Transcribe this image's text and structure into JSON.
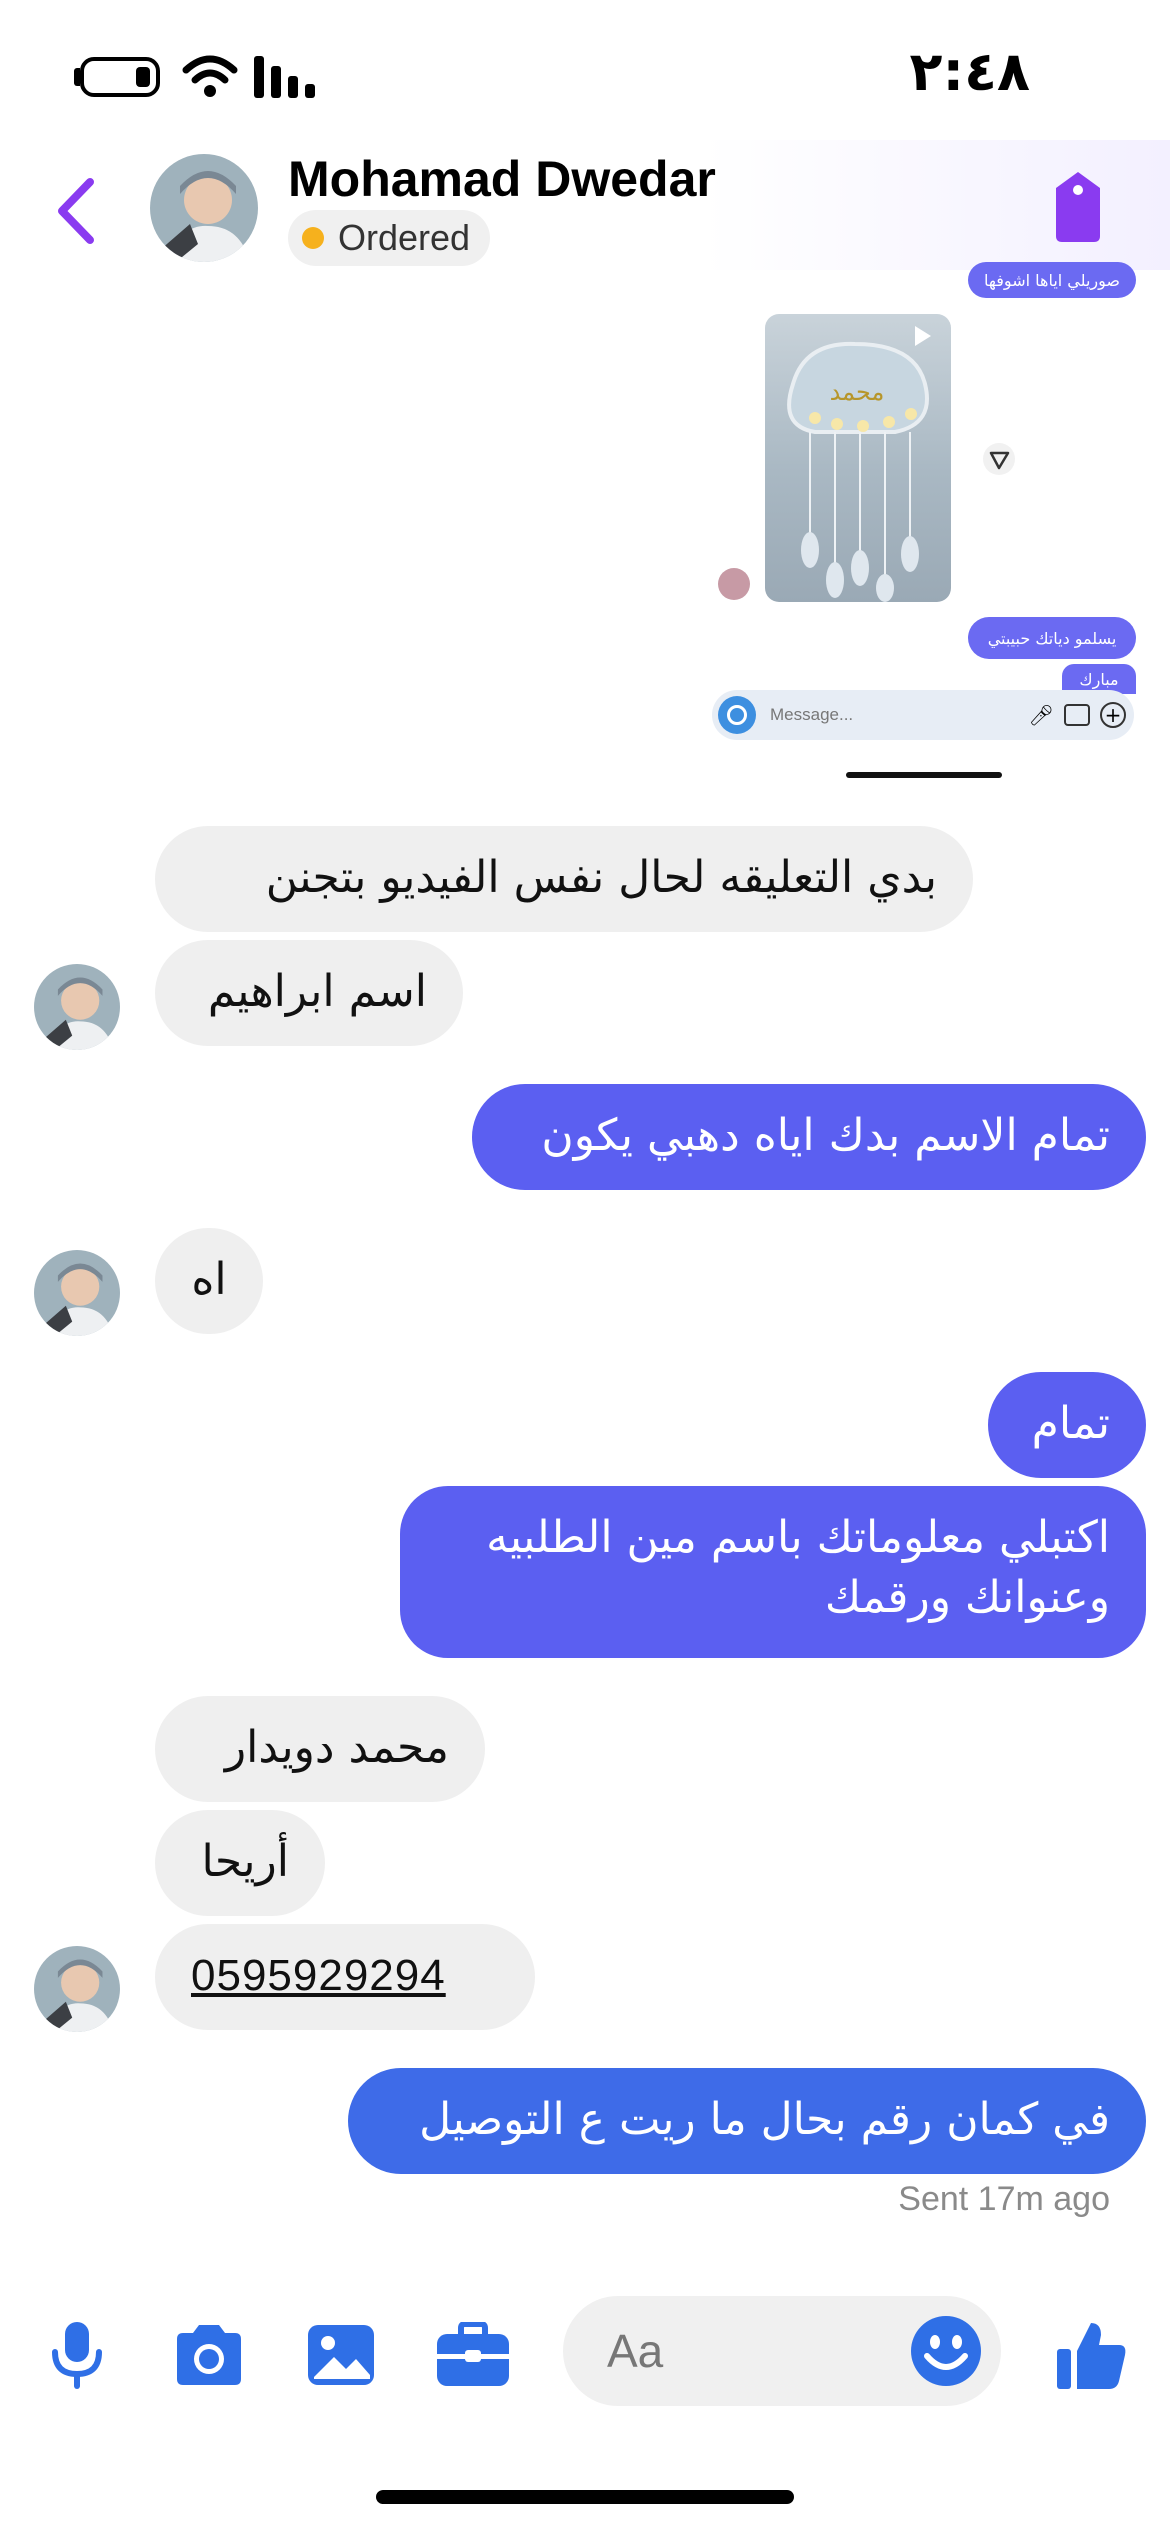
{
  "status_bar": {
    "time": "٢:٤٨"
  },
  "header": {
    "contact_name": "Mohamad Dwedar",
    "order_status": "Ordered",
    "colors": {
      "accent": "#7b2ff2",
      "order_dot": "#f6b11d"
    }
  },
  "shared_screenshot": {
    "top_bubble": "صوريلي اياها اشوفها",
    "photo_name": "محمد",
    "bubble_1": "يسلمو دياتك حبيبتي",
    "bubble_2": "مبارك",
    "input_placeholder": "Message..."
  },
  "messages": [
    {
      "direction": "incoming",
      "text": "بدي التعليقه لحال نفس الفيديو بتجنن"
    },
    {
      "direction": "incoming",
      "text": "اسم ابراهيم"
    },
    {
      "direction": "outgoing",
      "text": "تمام الاسم بدك اياه دهبي يكون"
    },
    {
      "direction": "incoming",
      "text": "اه"
    },
    {
      "direction": "outgoing",
      "text": "تمام"
    },
    {
      "direction": "outgoing",
      "lines": [
        "اكتبلي معلوماتك باسم مين الطلبيه",
        "وعنوانك ورقمك"
      ]
    },
    {
      "direction": "incoming",
      "text": "محمد دويدار"
    },
    {
      "direction": "incoming",
      "text": "أريحا"
    },
    {
      "direction": "incoming",
      "text": "0595929294"
    },
    {
      "direction": "outgoing",
      "text": "في كمان رقم بحال ما ريت ع التوصيل"
    }
  ],
  "sent_status": "Sent 17m ago",
  "composer": {
    "placeholder": "Aa",
    "icons": [
      "microphone-icon",
      "camera-icon",
      "gallery-icon",
      "briefcase-icon",
      "emoji-icon",
      "thumbs-up-icon"
    ],
    "accent": "#2f6fe6"
  }
}
